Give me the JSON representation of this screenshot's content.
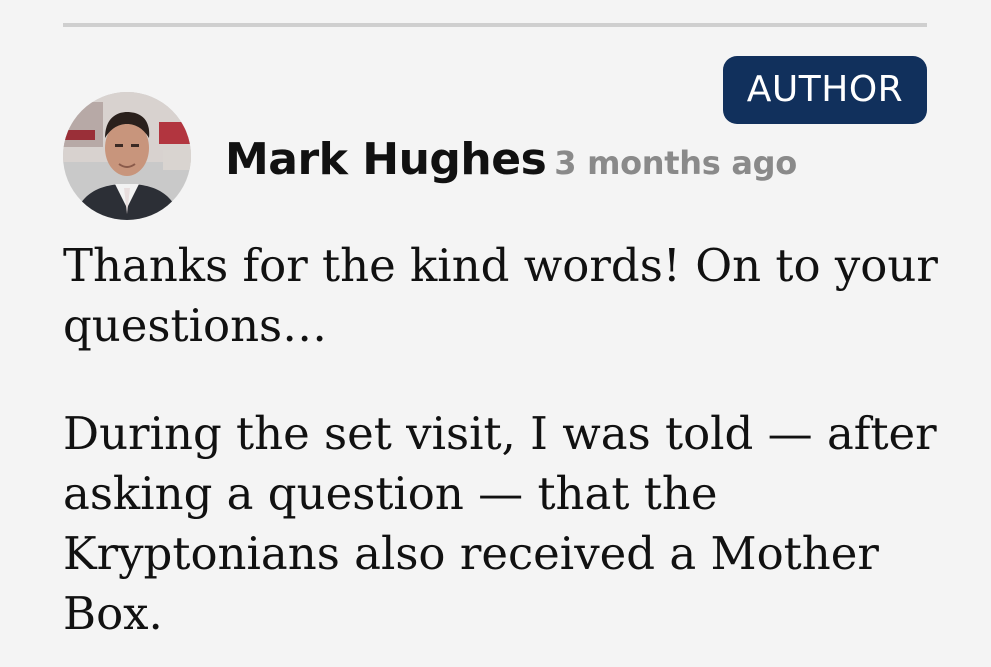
{
  "comment": {
    "badge": "AUTHOR",
    "author": "Mark Hughes",
    "timestamp": "3 months ago",
    "paragraphs": [
      "Thanks for the kind words! On to your questions…",
      "During the set visit, I was told — after asking a question — that the Kryptonians also received a Mother Box."
    ]
  },
  "colors": {
    "background": "#f4f4f4",
    "badge_bg": "#11305c",
    "badge_text": "#ffffff",
    "divider": "#cfcfcf",
    "name": "#111111",
    "timestamp": "#8a8a8a"
  },
  "icons": {
    "avatar": "author-avatar-photo"
  }
}
